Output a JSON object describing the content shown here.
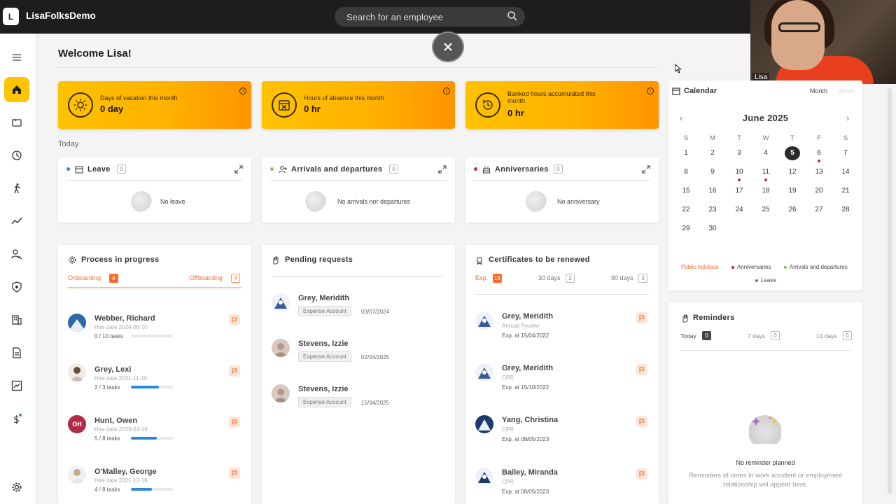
{
  "app": {
    "logo_letter": "L",
    "name": "LisaFolksDemo"
  },
  "search": {
    "placeholder": "Search for an employee"
  },
  "video": {
    "participant": "Lisa"
  },
  "welcome": "Welcome Lisa!",
  "stats": [
    {
      "label": "Days of vacation this month",
      "value": "0 day",
      "icon": "sun-icon"
    },
    {
      "label": "Hours of absence this month",
      "value": "0 hr",
      "icon": "calendar-x-icon"
    },
    {
      "label": "Banked hours accumulated this month",
      "value": "0 hr",
      "icon": "history-icon"
    }
  ],
  "today": {
    "label": "Today",
    "cards": [
      {
        "title": "Leave",
        "count": "0",
        "empty": "No leave",
        "dot_color": "#2a8ad6"
      },
      {
        "title": "Arrivals and departures",
        "count": "0",
        "empty": "No arrivals nor departures",
        "dot_color": "#8ac24a"
      },
      {
        "title": "Anniversaries",
        "count": "0",
        "empty": "No anniversary",
        "dot_color": "#c02a5a"
      }
    ]
  },
  "process": {
    "title": "Process in progress",
    "tab_onboarding": "Onboarding",
    "onboarding_count": "8",
    "tab_offboarding": "Offboarding",
    "offboarding_count": "4",
    "rows": [
      {
        "name": "Webber, Richard",
        "hire": "Hire date 2024-06-10",
        "tasks": "0 / 10 tasks",
        "progress": 0,
        "initials": ""
      },
      {
        "name": "Grey, Lexi",
        "hire": "Hire date 2021-11-30",
        "tasks": "2 / 3 tasks",
        "progress": 0.67,
        "initials": ""
      },
      {
        "name": "Hunt, Owen",
        "hire": "Hire date 2023-04-19",
        "tasks": "5 / 8 tasks",
        "progress": 0.62,
        "initials": "OH"
      },
      {
        "name": "O'Malley, George",
        "hire": "Hire date 2021-12-18",
        "tasks": "4 / 8 tasks",
        "progress": 0.5,
        "initials": ""
      }
    ]
  },
  "pending": {
    "title": "Pending requests",
    "rows": [
      {
        "name": "Grey, Meridith",
        "type": "Expense Account",
        "date": "03/07/2024"
      },
      {
        "name": "Stevens, Izzie",
        "type": "Expense Account",
        "date": "02/04/2025"
      },
      {
        "name": "Stevens, Izzie",
        "type": "Expense Account",
        "date": "15/04/2025"
      }
    ]
  },
  "certificates": {
    "title": "Certificates to be renewed",
    "tab_exp": "Exp.",
    "exp_count": "18",
    "tab_30": "30 days",
    "count_30": "2",
    "tab_90": "90 days",
    "count_90": "3",
    "rows": [
      {
        "name": "Grey, Meridith",
        "cert": "Annual Review",
        "exp": "Exp. at 15/04/2022"
      },
      {
        "name": "Grey, Meridith",
        "cert": "CPR",
        "exp": "Exp. at 15/10/2022"
      },
      {
        "name": "Yang, Christina",
        "cert": "CPR",
        "exp": "Exp. at 08/05/2023"
      },
      {
        "name": "Bailey, Miranda",
        "cert": "CPR",
        "exp": "Exp. at 08/05/2023"
      }
    ]
  },
  "calendar": {
    "title": "Calendar",
    "tab_month": "Month",
    "tab_week": "Week",
    "month": "June 2025",
    "prev": "‹",
    "next": "›",
    "dow": [
      "S",
      "M",
      "T",
      "W",
      "T",
      "F",
      "S"
    ],
    "weeks": [
      [
        "1",
        "2",
        "3",
        "4",
        "5",
        "6",
        "7"
      ],
      [
        "8",
        "9",
        "10",
        "11",
        "12",
        "13",
        "14"
      ],
      [
        "15",
        "16",
        "17",
        "18",
        "19",
        "20",
        "21"
      ],
      [
        "22",
        "23",
        "24",
        "25",
        "26",
        "27",
        "28"
      ],
      [
        "29",
        "30",
        "",
        "",
        "",
        "",
        ""
      ]
    ],
    "selected": "5",
    "marked": [
      "6",
      "10",
      "11"
    ],
    "legend": [
      {
        "label": "Public holidays",
        "color": "#ff6a2a"
      },
      {
        "label": "Anniversaries",
        "color": "#c02a3a"
      },
      {
        "label": "Arrivals and departures",
        "color": "#8ac24a"
      },
      {
        "label": "Leave",
        "color": "#2a8ad6"
      }
    ]
  },
  "reminders": {
    "title": "Reminders",
    "tab_today": "Today",
    "today_count": "0",
    "tab_7": "7 days",
    "count_7": "0",
    "tab_14": "14 days",
    "count_14": "0",
    "empty_title": "No reminder planned",
    "empty_text": "Reminders of notes in work accident or employment relationship will appear here."
  },
  "colors": {
    "accent": "#ffc400",
    "topbar": "#1d1d1d",
    "orange": "#ff6a2a",
    "blue": "#2a8ad6"
  }
}
